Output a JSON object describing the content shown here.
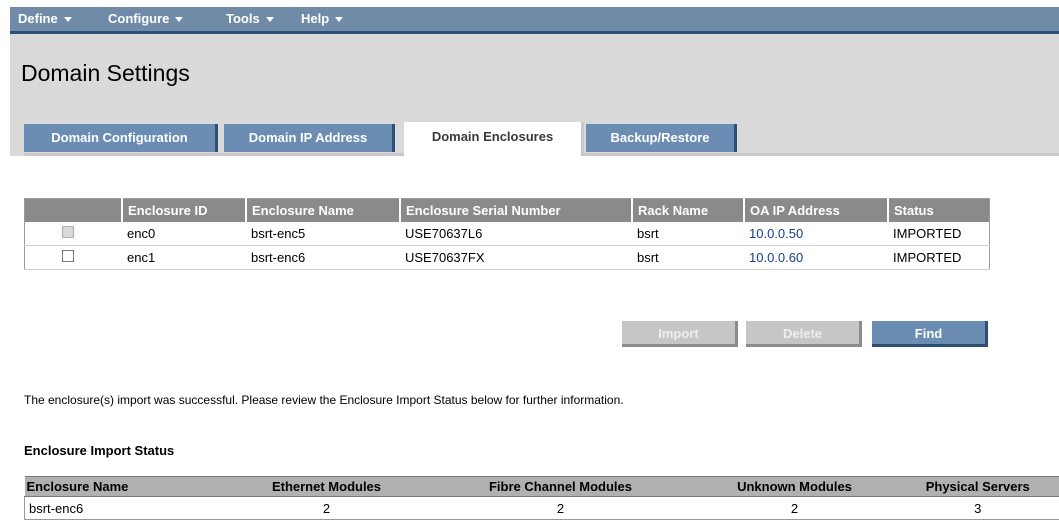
{
  "menu": {
    "items": [
      {
        "label": "Define"
      },
      {
        "label": "Configure"
      },
      {
        "label": "Tools"
      },
      {
        "label": "Help"
      }
    ]
  },
  "page": {
    "title": "Domain Settings"
  },
  "tabs": [
    {
      "label": "Domain Configuration",
      "active": false
    },
    {
      "label": "Domain IP Address",
      "active": false
    },
    {
      "label": "Domain Enclosures",
      "active": true
    },
    {
      "label": "Backup/Restore",
      "active": false
    }
  ],
  "enclosures": {
    "columns": [
      "",
      "Enclosure ID",
      "Enclosure Name",
      "Enclosure Serial Number",
      "Rack Name",
      "OA IP Address",
      "Status"
    ],
    "rows": [
      {
        "checked": false,
        "disabled": true,
        "id": "enc0",
        "name": "bsrt-enc5",
        "serial": "USE70637L6",
        "rack": "bsrt",
        "oa_ip": "10.0.0.50",
        "status": "IMPORTED"
      },
      {
        "checked": false,
        "disabled": false,
        "id": "enc1",
        "name": "bsrt-enc6",
        "serial": "USE70637FX",
        "rack": "bsrt",
        "oa_ip": "10.0.0.60",
        "status": "IMPORTED"
      }
    ]
  },
  "buttons": {
    "import": "Import",
    "delete": "Delete",
    "find": "Find"
  },
  "message": "The enclosure(s) import was successful. Please review the Enclosure Import Status below for further information.",
  "import_status": {
    "heading": "Enclosure Import Status",
    "columns": [
      "Enclosure Name",
      "Ethernet Modules",
      "Fibre Channel Modules",
      "Unknown Modules",
      "Physical Servers"
    ],
    "rows": [
      {
        "name": "bsrt-enc6",
        "ethernet": "2",
        "fibre": "2",
        "unknown": "2",
        "servers": "3"
      }
    ]
  },
  "colors": {
    "menubar": "#6f8ba8",
    "tab_inactive": "#6b8cb3",
    "link": "#1a3e8c"
  }
}
